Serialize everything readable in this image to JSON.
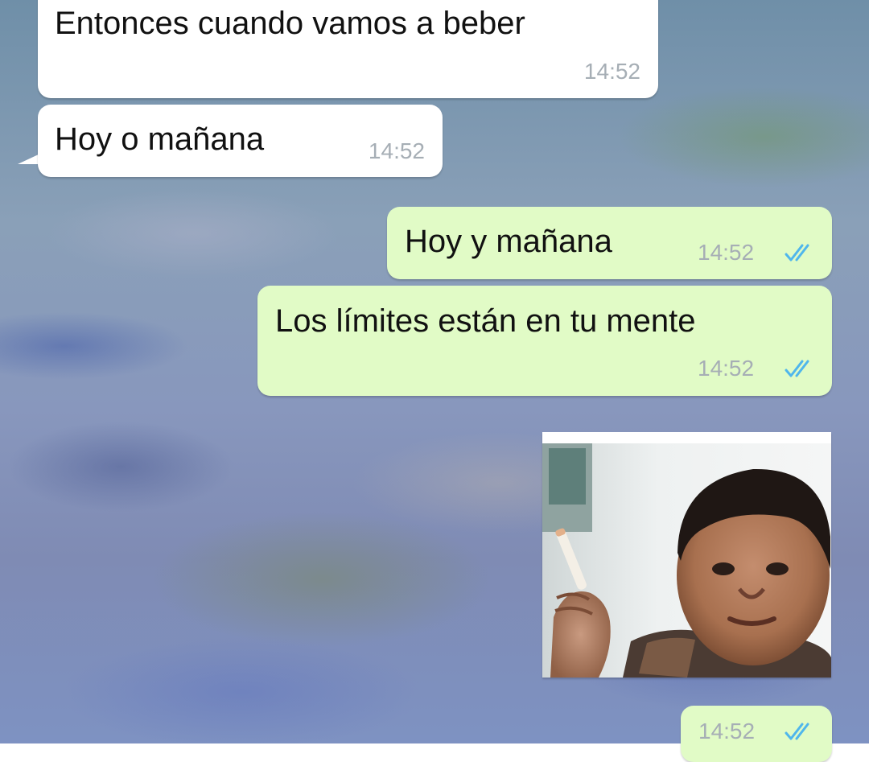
{
  "messages": [
    {
      "direction": "incoming",
      "text": "Entonces cuando vamos a beber",
      "time": "14:52"
    },
    {
      "direction": "incoming",
      "text": "Hoy o mañana",
      "time": "14:52"
    },
    {
      "direction": "outgoing",
      "text": "Hoy y mañana",
      "time": "14:52",
      "status": "read"
    },
    {
      "direction": "outgoing",
      "text": "Los límites están en tu mente",
      "time": "14:52",
      "status": "read"
    },
    {
      "direction": "outgoing",
      "type": "image",
      "time": "14:52",
      "status": "read"
    }
  ],
  "colors": {
    "incoming_bubble": "#ffffff",
    "outgoing_bubble": "#e1fbc6",
    "read_ticks": "#4fb6ec",
    "timestamp": "#a6aeb5"
  },
  "icons": {
    "read_receipt": "double-check-icon"
  }
}
